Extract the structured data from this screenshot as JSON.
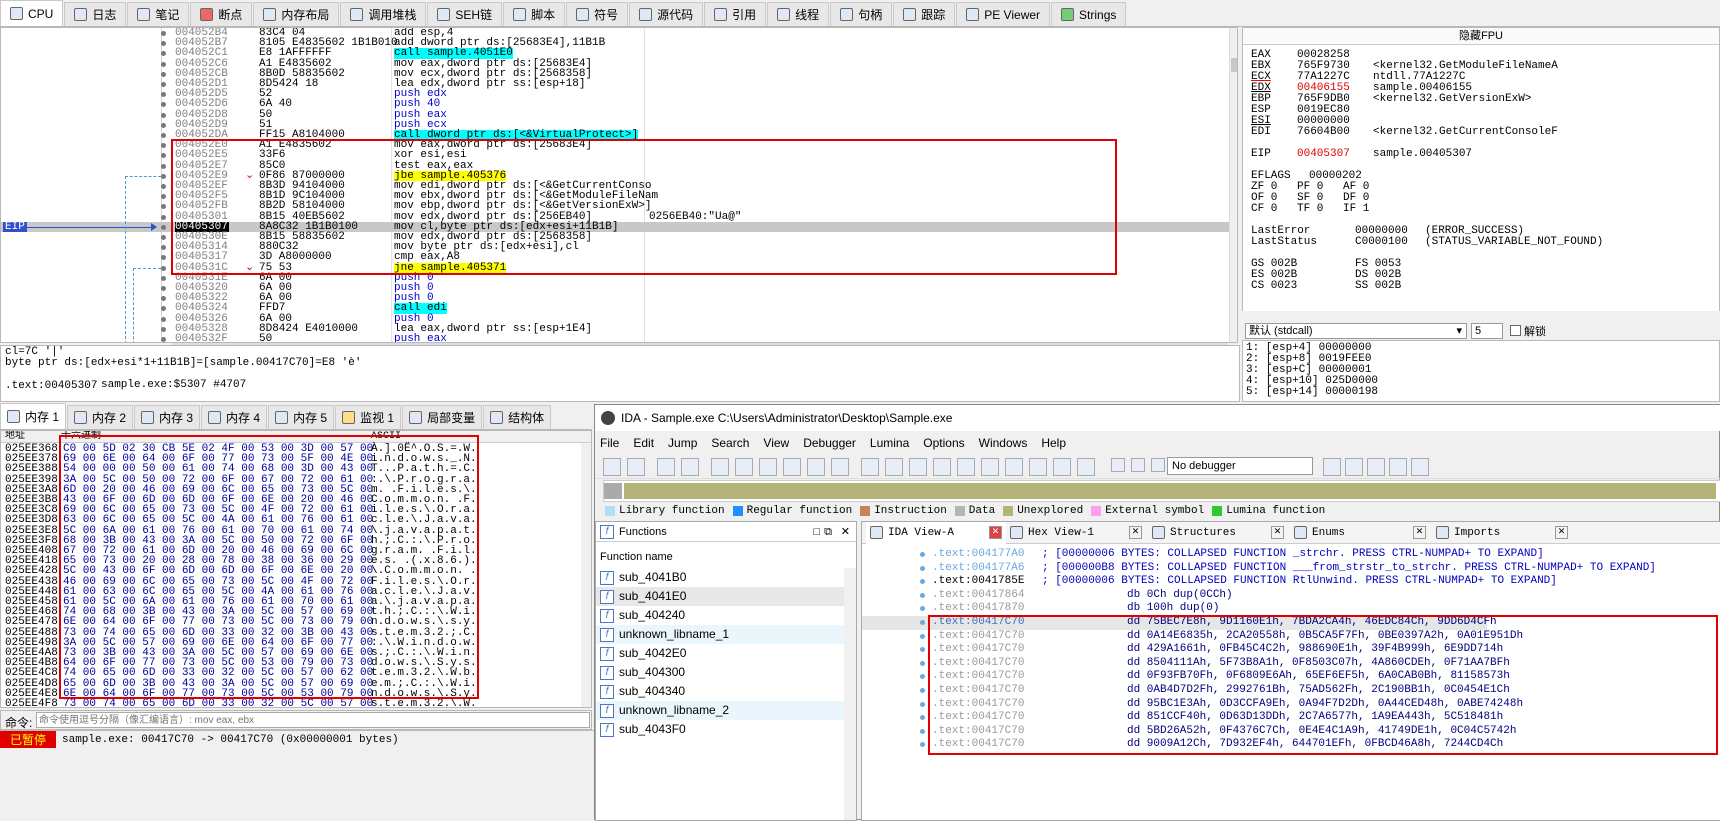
{
  "tabs": [
    {
      "label": "CPU",
      "active": true
    },
    {
      "label": "日志"
    },
    {
      "label": "笔记"
    },
    {
      "label": "断点"
    },
    {
      "label": "内存布局"
    },
    {
      "label": "调用堆栈"
    },
    {
      "label": "SEH链"
    },
    {
      "label": "脚本"
    },
    {
      "label": "符号"
    },
    {
      "label": "源代码"
    },
    {
      "label": "引用"
    },
    {
      "label": "线程"
    },
    {
      "label": "句柄"
    },
    {
      "label": "跟踪"
    },
    {
      "label": "PE Viewer"
    },
    {
      "label": "Strings"
    }
  ],
  "disasm": {
    "rows": [
      {
        "a": "004052B4",
        "b": "83C4 04",
        "i": "add esp,4"
      },
      {
        "a": "004052B7",
        "b": "8105 E4835602 1B1B010",
        "i": "add dword ptr ds:[25683E4],11B1B"
      },
      {
        "a": "004052C1",
        "b": "E8 1AFFFFFF",
        "i": "call sample.4051E0",
        "t": "call"
      },
      {
        "a": "004052C6",
        "b": "A1 E4835602",
        "i": "mov eax,dword ptr ds:[25683E4]"
      },
      {
        "a": "004052CB",
        "b": "8B0D 58835602",
        "i": "mov ecx,dword ptr ds:[2568358]"
      },
      {
        "a": "004052D1",
        "b": "8D5424 18",
        "i": "lea edx,dword ptr ss:[esp+18]"
      },
      {
        "a": "004052D5",
        "b": "52",
        "i": "push edx",
        "t": "push"
      },
      {
        "a": "004052D6",
        "b": "6A 40",
        "i": "push 40",
        "t": "push"
      },
      {
        "a": "004052D8",
        "b": "50",
        "i": "push eax",
        "t": "push"
      },
      {
        "a": "004052D9",
        "b": "51",
        "i": "push ecx",
        "t": "push"
      },
      {
        "a": "004052DA",
        "b": "FF15 A8104000",
        "i": "call dword ptr ds:[<&VirtualProtect>]",
        "t": "call"
      },
      {
        "a": "004052E0",
        "b": "A1 E4835602",
        "i": "mov eax,dword ptr ds:[25683E4]"
      },
      {
        "a": "004052E5",
        "b": "33F6",
        "i": "xor esi,esi"
      },
      {
        "a": "004052E7",
        "b": "85C0",
        "i": "test eax,eax"
      },
      {
        "a": "004052E9",
        "b": "0F86 87000000",
        "i": "jbe sample.405376",
        "t": "jmp",
        "m": "v"
      },
      {
        "a": "004052EF",
        "b": "8B3D 94104000",
        "i": "mov edi,dword ptr ds:[<&GetCurrentConso"
      },
      {
        "a": "004052F5",
        "b": "8B1D 9C104000",
        "i": "mov ebx,dword ptr ds:[<&GetModuleFileNam"
      },
      {
        "a": "004052FB",
        "b": "8B2D 58104000",
        "i": "mov ebp,dword ptr ds:[<&GetVersionExW>]"
      },
      {
        "a": "00405301",
        "b": "8B15 40EB5602",
        "i": "mov edx,dword ptr ds:[256EB40]",
        "c": "0256EB40:\"Ua@\""
      },
      {
        "a": "00405307",
        "b": "8A8C32 1B1B0100",
        "i": "mov cl,byte ptr ds:[edx+esi+11B1B]",
        "t": "eip"
      },
      {
        "a": "0040530E",
        "b": "8B15 58835602",
        "i": "mov edx,dword ptr ds:[2568358]"
      },
      {
        "a": "00405314",
        "b": "880C32",
        "i": "mov byte ptr ds:[edx+esi],cl"
      },
      {
        "a": "00405317",
        "b": "3D A8000000",
        "i": "cmp eax,A8"
      },
      {
        "a": "0040531C",
        "b": "75 53",
        "i": "jne sample.405371",
        "t": "jmp",
        "m": "v"
      },
      {
        "a": "0040531E",
        "b": "6A 00",
        "i": "push 0",
        "t": "push"
      },
      {
        "a": "00405320",
        "b": "6A 00",
        "i": "push 0",
        "t": "push"
      },
      {
        "a": "00405322",
        "b": "6A 00",
        "i": "push 0",
        "t": "push"
      },
      {
        "a": "00405324",
        "b": "FFD7",
        "i": "call edi",
        "t": "call"
      },
      {
        "a": "00405326",
        "b": "6A 00",
        "i": "push 0",
        "t": "push"
      },
      {
        "a": "00405328",
        "b": "8D8424 E4010000",
        "i": "lea eax,dword ptr ss:[esp+1E4]"
      },
      {
        "a": "0040532F",
        "b": "50",
        "i": "push eax",
        "t": "push"
      },
      {
        "a": "00405330",
        "b": "6A 00",
        "i": "push 0",
        "t": "push"
      }
    ],
    "eip_label": "EIP"
  },
  "registers": {
    "header": "隐藏FPU",
    "lines": [
      {
        "n": "EAX",
        "v": "00028258",
        "c": ""
      },
      {
        "n": "EBX",
        "v": "765F9730",
        "c": "<kernel32.GetModuleFileNameA"
      },
      {
        "n": "ECX",
        "v": "77A1227C",
        "c": "ntdll.77A1227C"
      },
      {
        "n": "EDX",
        "v": "00406155",
        "c": "sample.00406155",
        "red": true
      },
      {
        "n": "EBP",
        "v": "765F9DB0",
        "c": "<kernel32.GetVersionExW>"
      },
      {
        "n": "ESP",
        "v": "0019EC80",
        "c": ""
      },
      {
        "n": "ESI",
        "v": "00000000",
        "c": ""
      },
      {
        "n": "EDI",
        "v": "76604B00",
        "c": "<kernel32.GetCurrentConsoleF"
      },
      {
        "n": "",
        "v": "",
        "c": ""
      },
      {
        "n": "EIP",
        "v": "00405307",
        "c": "sample.00405307",
        "red": true
      },
      {
        "n": "",
        "v": "",
        "c": ""
      },
      {
        "n": "EFLAGS",
        "v": "00000202",
        "c": ""
      },
      {
        "n": "ZF 0",
        "v": "PF 0",
        "c": "AF 0"
      },
      {
        "n": "OF 0",
        "v": "SF 0",
        "c": "DF 0"
      },
      {
        "n": "CF 0",
        "v": "TF 0",
        "c": "IF 1"
      },
      {
        "n": "",
        "v": "",
        "c": ""
      },
      {
        "n": "LastError",
        "v": "00000000",
        "c": "(ERROR_SUCCESS)"
      },
      {
        "n": "LastStatus",
        "v": "C0000100",
        "c": "(STATUS_VARIABLE_NOT_FOUND)"
      },
      {
        "n": "",
        "v": "",
        "c": ""
      },
      {
        "n": "GS 002B",
        "v": "FS 0053",
        "c": ""
      },
      {
        "n": "ES 002B",
        "v": "DS 002B",
        "c": ""
      },
      {
        "n": "CS 0023",
        "v": "SS 002B",
        "c": ""
      }
    ],
    "callconv": "默认 (stdcall)",
    "argcount": "5",
    "unlock": "解锁"
  },
  "stack": [
    "1: [esp+4] 00000000",
    "2: [esp+8] 0019FEE0",
    "3: [esp+C] 00000001",
    "4: [esp+10] 025D0000",
    "5: [esp+14] 00000198"
  ],
  "info": [
    "cl=7C '|'",
    "byte ptr ds:[edx+esi*1+11B1B]=[sample.00417C70]=E8 'è'",
    "",
    "sample.exe:$5307 #4707"
  ],
  "info_addr": ".text:00405307",
  "dump_tabs": [
    {
      "label": "内存 1",
      "active": true
    },
    {
      "label": "内存 2"
    },
    {
      "label": "内存 3"
    },
    {
      "label": "内存 4"
    },
    {
      "label": "内存 5"
    },
    {
      "label": "监视 1"
    },
    {
      "label": "局部变量"
    },
    {
      "label": "结构体"
    }
  ],
  "dump": {
    "headers": [
      "地址",
      "十六进制",
      "ASCII"
    ],
    "rows": [
      [
        "025EE368",
        "C0 00 5D 02 30 CB 5E 02 4F 00 53 00 3D 00 57 00",
        "À.].0Ë^.O.S.=.W."
      ],
      [
        "025EE378",
        "69 00 6E 00 64 00 6F 00 77 00 73 00 5F 00 4E 00",
        "i.n.d.o.w.s._.N."
      ],
      [
        "025EE388",
        "54 00 00 00 50 00 61 00 74 00 68 00 3D 00 43 00",
        "T...P.a.t.h.=.C."
      ],
      [
        "025EE398",
        "3A 00 5C 00 50 00 72 00 6F 00 67 00 72 00 61 00",
        ":.\\.P.r.o.g.r.a."
      ],
      [
        "025EE3A8",
        "6D 00 20 00 46 00 69 00 6C 00 65 00 73 00 5C 00",
        "m. .F.i.l.e.s.\\."
      ],
      [
        "025EE3B8",
        "43 00 6F 00 6D 00 6D 00 6F 00 6E 00 20 00 46 00",
        "C.o.m.m.o.n. .F."
      ],
      [
        "025EE3C8",
        "69 00 6C 00 65 00 73 00 5C 00 4F 00 72 00 61 00",
        "i.l.e.s.\\.O.r.a."
      ],
      [
        "025EE3D8",
        "63 00 6C 00 65 00 5C 00 4A 00 61 00 76 00 61 00",
        "c.l.e.\\.J.a.v.a."
      ],
      [
        "025EE3E8",
        "5C 00 6A 00 61 00 76 00 61 00 70 00 61 00 74 00",
        "\\.j.a.v.a.p.a.t."
      ],
      [
        "025EE3F8",
        "68 00 3B 00 43 00 3A 00 5C 00 50 00 72 00 6F 00",
        "h.;.C.:.\\.P.r.o."
      ],
      [
        "025EE408",
        "67 00 72 00 61 00 6D 00 20 00 46 00 69 00 6C 00",
        "g.r.a.m. .F.i.l."
      ],
      [
        "025EE418",
        "65 00 73 00 20 00 28 00 78 00 38 00 36 00 29 00",
        "e.s. .(.x.8.6.)."
      ],
      [
        "025EE428",
        "5C 00 43 00 6F 00 6D 00 6D 00 6F 00 6E 00 20 00",
        "\\.C.o.m.m.o.n. ."
      ],
      [
        "025EE438",
        "46 00 69 00 6C 00 65 00 73 00 5C 00 4F 00 72 00",
        "F.i.l.e.s.\\.O.r."
      ],
      [
        "025EE448",
        "61 00 63 00 6C 00 65 00 5C 00 4A 00 61 00 76 00",
        "a.c.l.e.\\.J.a.v."
      ],
      [
        "025EE458",
        "61 00 5C 00 6A 00 61 00 76 00 61 00 70 00 61 00",
        "a.\\.j.a.v.a.p.a."
      ],
      [
        "025EE468",
        "74 00 68 00 3B 00 43 00 3A 00 5C 00 57 00 69 00",
        "t.h.;.C.:.\\.W.i."
      ],
      [
        "025EE478",
        "6E 00 64 00 6F 00 77 00 73 00 5C 00 73 00 79 00",
        "n.d.o.w.s.\\.s.y."
      ],
      [
        "025EE488",
        "73 00 74 00 65 00 6D 00 33 00 32 00 3B 00 43 00",
        "s.t.e.m.3.2.;.C."
      ],
      [
        "025EE498",
        "3A 00 5C 00 57 00 69 00 6E 00 64 00 6F 00 77 00",
        ":.\\.W.i.n.d.o.w."
      ],
      [
        "025EE4A8",
        "73 00 3B 00 43 00 3A 00 5C 00 57 00 69 00 6E 00",
        "s.;.C.:.\\.W.i.n."
      ],
      [
        "025EE4B8",
        "64 00 6F 00 77 00 73 00 5C 00 53 00 79 00 73 00",
        "d.o.w.s.\\.S.y.s."
      ],
      [
        "025EE4C8",
        "74 00 65 00 6D 00 33 00 32 00 5C 00 57 00 62 00",
        "t.e.m.3.2.\\.W.b."
      ],
      [
        "025EE4D8",
        "65 00 6D 00 3B 00 43 00 3A 00 5C 00 57 00 69 00",
        "e.m.;.C.:.\\.W.i."
      ],
      [
        "025EE4E8",
        "6E 00 64 00 6F 00 77 00 73 00 5C 00 53 00 79 00",
        "n.d.o.w.s.\\.S.y."
      ],
      [
        "025EE4F8",
        "73 00 74 00 65 00 6D 00 33 00 32 00 5C 00 57 00",
        "s.t.e.m.3.2.\\.W."
      ]
    ]
  },
  "command": {
    "label": "命令:",
    "placeholder": "命令使用逗号分隔（像汇编语言）: mov eax, ebx"
  },
  "status": {
    "state": "已暂停",
    "text": "sample.exe: 00417C70 -> 00417C70 (0x00000001 bytes)"
  },
  "ida": {
    "title": "IDA - Sample.exe C:\\Users\\Administrator\\Desktop\\Sample.exe",
    "menu": [
      "File",
      "Edit",
      "Jump",
      "Search",
      "View",
      "Debugger",
      "Lumina",
      "Options",
      "Windows",
      "Help"
    ],
    "debugger": "No debugger",
    "legend": [
      {
        "label": "Library function",
        "color": "#aee0f5"
      },
      {
        "label": "Regular function",
        "color": "#1e90ff"
      },
      {
        "label": "Instruction",
        "color": "#c8825a"
      },
      {
        "label": "Data",
        "color": "#b4b4b4"
      },
      {
        "label": "Unexplored",
        "color": "#b4b478"
      },
      {
        "label": "External symbol",
        "color": "#ff9ef0"
      },
      {
        "label": "Lumina function",
        "color": "#32c832"
      }
    ],
    "functions_title": "Functions",
    "functions_header": "Function name",
    "functions": [
      "sub_4041B0",
      "sub_4041E0",
      "sub_404240",
      "unknown_libname_1",
      "sub_4042E0",
      "sub_404300",
      "sub_404340",
      "unknown_libname_2",
      "sub_4043F0"
    ],
    "view_tabs": [
      "IDA View-A",
      "Hex View-1",
      "Structures",
      "Enums",
      "Imports"
    ],
    "lines": [
      {
        "a": ".text:004177A0",
        "t": "; [00000006 BYTES: COLLAPSED FUNCTION _strchr. PRESS CTRL-NUMPAD+ TO EXPAND]",
        "k": "col"
      },
      {
        "a": ".text:004177A6",
        "t": "; [000000B8 BYTES: COLLAPSED FUNCTION ___from_strstr_to_strchr. PRESS CTRL-NUMPAD+ TO EXPAND]",
        "k": "col"
      },
      {
        "a": ".text:0041785E",
        "t": "; [00000006 BYTES: COLLAPSED FUNCTION RtlUnwind. PRESS CTRL-NUMPAD+ TO EXPAND]",
        "k": "col"
      },
      {
        "a": ".text:00417864",
        "t": "db 0Ch dup(0CCh)",
        "k": "db"
      },
      {
        "a": ".text:00417870",
        "t": "db 100h dup(0)",
        "k": "db"
      },
      {
        "a": ".text:00417C70",
        "t": "dd 75BEC7E8h, 9D1160E1h, 7BDA2CA4h, 46EDC84Ch, 9DD6D4CFh",
        "k": "sel"
      },
      {
        "a": ".text:00417C70",
        "t": "dd 0A14E6835h, 2CA20558h, 0B5CA5F7Fh, 0BE0397A2h, 0A01E951Dh",
        "k": "dd"
      },
      {
        "a": ".text:00417C70",
        "t": "dd 429A1661h, 0FB45C4C2h, 988690E1h, 39F4B999h, 6E9DD714h",
        "k": "dd"
      },
      {
        "a": ".text:00417C70",
        "t": "dd 8504111Ah, 5F73B8A1h, 0F8503C07h, 4A860CDEh, 0F71AA7BFh",
        "k": "dd"
      },
      {
        "a": ".text:00417C70",
        "t": "dd 0F93FB70Fh, 0F6809E6Ah, 65EF6EF5h, 6A0CAB0Bh, 81158573h",
        "k": "dd"
      },
      {
        "a": ".text:00417C70",
        "t": "dd 0AB4D7D2Fh, 2992761Bh, 75AD562Fh, 2C190BB1h, 0C0454E1Ch",
        "k": "dd"
      },
      {
        "a": ".text:00417C70",
        "t": "dd 95BC1E3Ah, 0D3CCFA9Eh, 0A94F7D2Dh, 0A44CED48h, 0ABE74248h",
        "k": "dd"
      },
      {
        "a": ".text:00417C70",
        "t": "dd 851CCF40h, 0D63D13DDh, 2C7A6577h, 1A9EA443h, 5C518481h",
        "k": "dd"
      },
      {
        "a": ".text:00417C70",
        "t": "dd 5BD26A52h, 0F4376C7Ch, 0E4E4C1A9h, 41749DE1h, 0C04C5742h",
        "k": "dd"
      },
      {
        "a": ".text:00417C70",
        "t": "dd 9009A12Ch, 7D932EF4h, 644701EFh, 0FBCD46A8h, 7244CD4Ch",
        "k": "dd"
      }
    ]
  }
}
